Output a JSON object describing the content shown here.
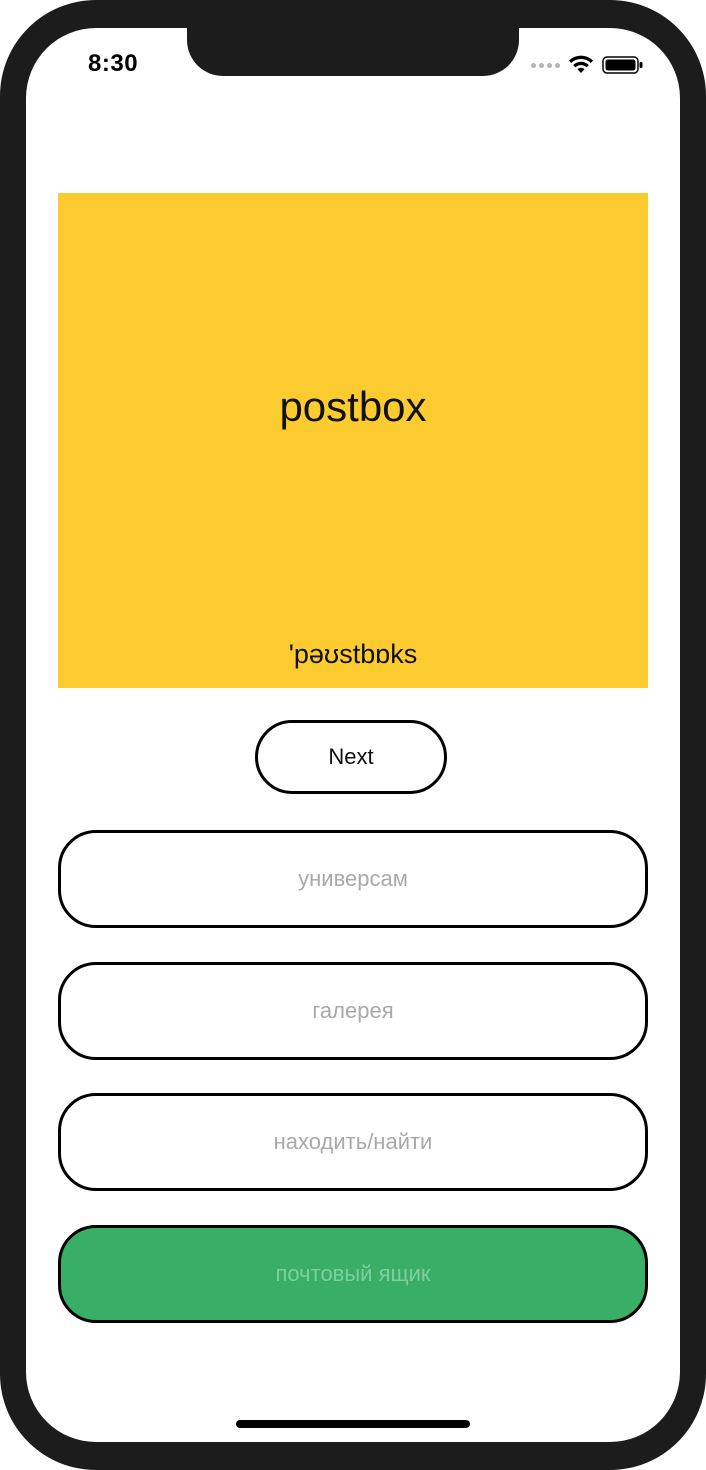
{
  "status_bar": {
    "time": "8:30",
    "icons": [
      "signal-dots-icon",
      "wifi-icon",
      "battery-icon"
    ]
  },
  "card": {
    "word": "postbox",
    "transcription": "'pəʊstbɒks",
    "background_color": "#fccb30"
  },
  "next_button": {
    "label": "Next"
  },
  "options": [
    {
      "label": "универсам",
      "state": "default"
    },
    {
      "label": "галерея",
      "state": "default"
    },
    {
      "label": "находить/найти",
      "state": "default"
    },
    {
      "label": "почтовый ящик",
      "state": "correct"
    }
  ],
  "colors": {
    "correct": "#38ae66",
    "option_text": "#a9a9a9"
  }
}
